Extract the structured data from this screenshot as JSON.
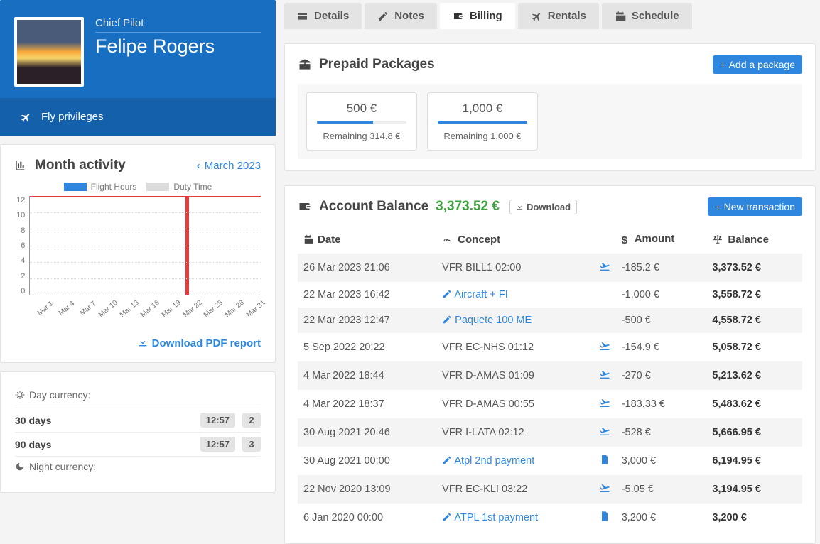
{
  "profile": {
    "role": "Chief Pilot",
    "first_name": "Felipe",
    "last_name": "Rogers",
    "fly_privileges_label": "Fly privileges"
  },
  "month_activity": {
    "title": "Month activity",
    "period": "March 2023",
    "legend_flight_hours": "Flight Hours",
    "legend_duty_time": "Duty Time",
    "pdf_label": "Download PDF report"
  },
  "chart_data": {
    "type": "bar",
    "title": "Month activity",
    "xlabel": "",
    "ylabel": "",
    "ylim": [
      0,
      12
    ],
    "y_ticks": [
      12,
      10,
      8,
      6,
      4,
      2,
      0
    ],
    "categories": [
      "Mar 1",
      "Mar 4",
      "Mar 7",
      "Mar 10",
      "Mar 13",
      "Mar 16",
      "Mar 19",
      "Mar 22",
      "Mar 25",
      "Mar 28",
      "Mar 31"
    ],
    "series": [
      {
        "name": "Flight Hours",
        "values": [
          0,
          0,
          0,
          0,
          0,
          0,
          0,
          12,
          0,
          0,
          0
        ]
      },
      {
        "name": "Duty Time",
        "values": [
          0,
          0,
          0,
          0,
          0,
          0,
          0,
          0,
          0,
          0,
          0
        ]
      }
    ],
    "reference_line": 12
  },
  "currency": {
    "day_label": "Day currency:",
    "night_label": "Night currency:",
    "rows": [
      {
        "label": "30 days",
        "time": "12:57",
        "count": "2"
      },
      {
        "label": "90 days",
        "time": "12:57",
        "count": "3"
      }
    ]
  },
  "tabs": [
    {
      "id": "details",
      "label": "Details"
    },
    {
      "id": "notes",
      "label": "Notes"
    },
    {
      "id": "billing",
      "label": "Billing",
      "active": true
    },
    {
      "id": "rentals",
      "label": "Rentals"
    },
    {
      "id": "schedule",
      "label": "Schedule"
    }
  ],
  "packages": {
    "title": "Prepaid Packages",
    "add_label": "Add a package",
    "items": [
      {
        "amount": "500 €",
        "remaining": "Remaining 314.8 €",
        "pct": 63
      },
      {
        "amount": "1,000 €",
        "remaining": "Remaining 1,000 €",
        "pct": 100
      }
    ]
  },
  "balance": {
    "title": "Account Balance",
    "value": "3,373.52 €",
    "download_label": "Download",
    "new_tx_label": "New transaction",
    "columns": {
      "date": "Date",
      "concept": "Concept",
      "amount": "Amount",
      "balance": "Balance"
    },
    "rows": [
      {
        "date": "26 Mar 2023 21:06",
        "concept": "VFR BILL1 02:00",
        "link": false,
        "icon": "plane",
        "amount": "-185.2 €",
        "balance": "3,373.52 €"
      },
      {
        "date": "22 Mar 2023 16:42",
        "concept": "Aircraft + FI",
        "link": true,
        "icon": "",
        "amount": "-1,000 €",
        "balance": "3,558.72 €"
      },
      {
        "date": "22 Mar 2023 12:47",
        "concept": "Paquete 100 ME",
        "link": true,
        "icon": "",
        "amount": "-500 €",
        "balance": "4,558.72 €"
      },
      {
        "date": "5 Sep 2022 20:22",
        "concept": "VFR EC-NHS 01:12",
        "link": false,
        "icon": "plane",
        "amount": "-154.9 €",
        "balance": "5,058.72 €"
      },
      {
        "date": "4 Mar 2022 18:44",
        "concept": "VFR D-AMAS 01:09",
        "link": false,
        "icon": "plane",
        "amount": "-270 €",
        "balance": "5,213.62 €"
      },
      {
        "date": "4 Mar 2022 18:37",
        "concept": "VFR D-AMAS 00:55",
        "link": false,
        "icon": "plane",
        "amount": "-183.33 €",
        "balance": "5,483.62 €"
      },
      {
        "date": "30 Aug 2021 20:46",
        "concept": "VFR I-LATA 02:12",
        "link": false,
        "icon": "plane",
        "amount": "-528 €",
        "balance": "5,666.95 €"
      },
      {
        "date": "30 Aug 2021 00:00",
        "concept": "Atpl 2nd payment",
        "link": true,
        "icon": "doc",
        "amount": "3,000 €",
        "balance": "6,194.95 €"
      },
      {
        "date": "22 Nov 2020 13:09",
        "concept": "VFR EC-KLI 03:22",
        "link": false,
        "icon": "plane",
        "amount": "-5.05 €",
        "balance": "3,194.95 €"
      },
      {
        "date": "6 Jan 2020 00:00",
        "concept": "ATPL 1st payment",
        "link": true,
        "icon": "doc",
        "amount": "3,200 €",
        "balance": "3,200 €"
      }
    ]
  }
}
